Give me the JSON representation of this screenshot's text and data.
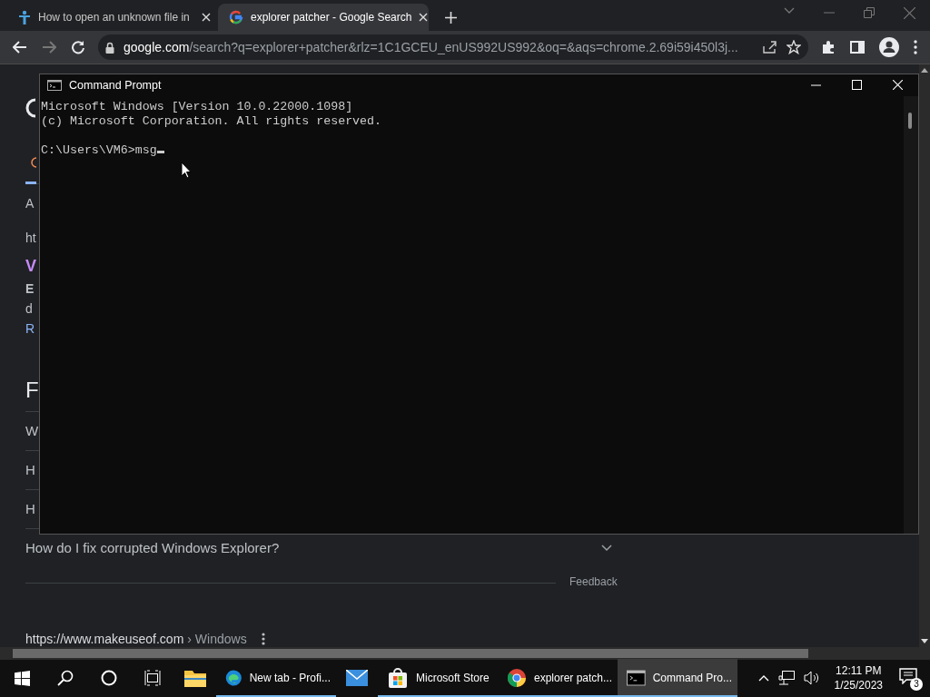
{
  "browser": {
    "tabs": [
      {
        "title": "How to open an unknown file in",
        "kind": "article",
        "selected": false
      },
      {
        "title": "explorer patcher - Google Search",
        "kind": "google",
        "selected": true
      }
    ],
    "address": {
      "domain": "google.com",
      "path": "/search?q=explorer+patcher&rlz=1C1GCEU_enUS992US992&oq=&aqs=chrome.2.69i59i450l3j..."
    }
  },
  "page": {
    "fragments": [
      {
        "text": "A",
        "kind": "muted"
      },
      {
        "text": "ht",
        "kind": "muted"
      },
      {
        "text": "V",
        "kind": "visited"
      },
      {
        "text": "E",
        "kind": "bold"
      },
      {
        "text": "d",
        "kind": "muted"
      },
      {
        "text": "R",
        "kind": "link"
      },
      {
        "text": "F",
        "kind": "heading"
      }
    ],
    "faq": [
      {
        "question": "W"
      },
      {
        "question": "H"
      },
      {
        "question": "H"
      },
      {
        "question": "How do I fix corrupted Windows Explorer?"
      }
    ],
    "feedback": "Feedback",
    "result": {
      "site": "https://www.makeuseof.com",
      "crumb": "› Windows"
    }
  },
  "cmd": {
    "title": "Command Prompt",
    "lines": [
      "Microsoft Windows [Version 10.0.22000.1098]",
      "(c) Microsoft Corporation. All rights reserved."
    ],
    "prompt": "C:\\Users\\VM6>msg"
  },
  "taskbar": {
    "apps": [
      {
        "kind": "folder",
        "running": false,
        "selected": false
      },
      {
        "kind": "edge",
        "label": "New tab - Profi...",
        "running": true,
        "selected": false
      },
      {
        "kind": "mail",
        "running": false,
        "selected": false
      },
      {
        "kind": "store",
        "label": "Microsoft Store",
        "running": true,
        "selected": false
      },
      {
        "kind": "chrome",
        "label": "explorer patch...",
        "running": true,
        "selected": false
      },
      {
        "kind": "terminal",
        "label": "Command Pro...",
        "running": true,
        "selected": true
      }
    ],
    "clock": {
      "time": "12:11 PM",
      "date": "1/25/2023"
    },
    "notifications": "3"
  }
}
